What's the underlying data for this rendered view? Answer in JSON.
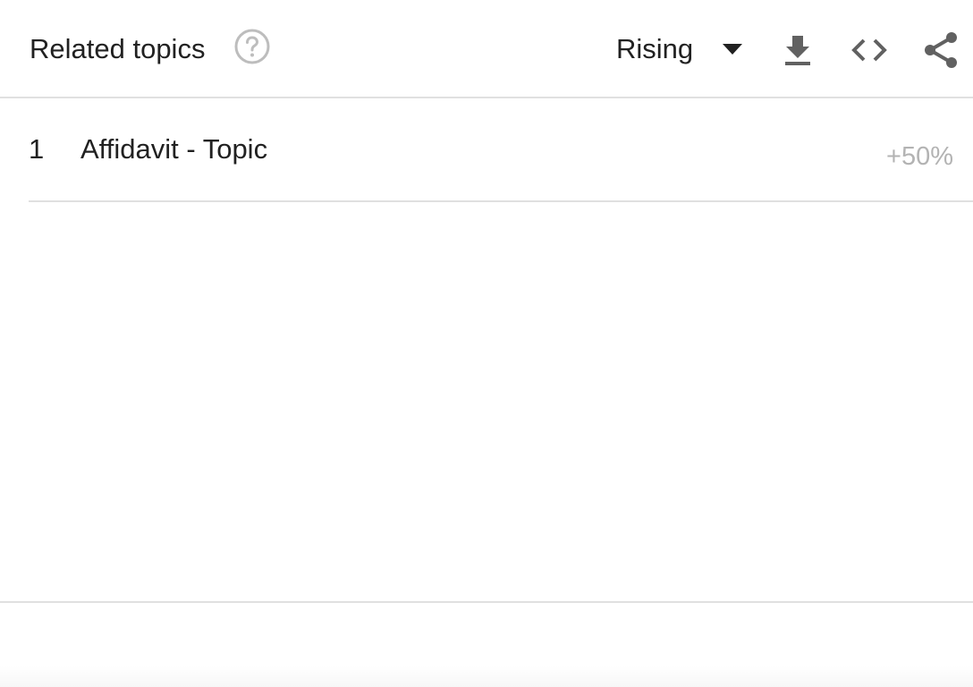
{
  "header": {
    "title": "Related topics",
    "help_icon": "help-circle-icon",
    "sort": {
      "selected": "Rising",
      "caret_icon": "caret-down-icon"
    },
    "actions": {
      "download_icon": "download-icon",
      "embed_icon": "code-embed-icon",
      "share_icon": "share-icon"
    }
  },
  "list": {
    "items": [
      {
        "rank": "1",
        "topic": "Affidavit - Topic",
        "value": "+50%"
      }
    ]
  },
  "colors": {
    "text": "#212121",
    "muted": "#b3b3b3",
    "icon": "#616161",
    "help_icon": "#bdbdbd",
    "divider": "#e0e0e0"
  }
}
